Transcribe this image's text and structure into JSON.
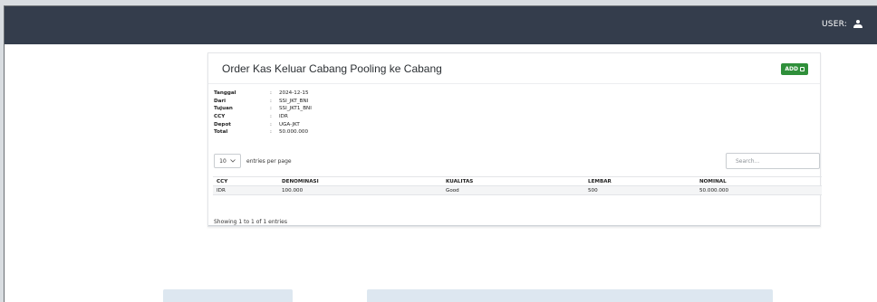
{
  "header": {
    "user_label": "USER:"
  },
  "card": {
    "title": "Order Kas Keluar Cabang Pooling ke Cabang",
    "add_label": "ADD"
  },
  "info": [
    {
      "key": "Tanggal",
      "sep": ":",
      "value": "2024-12-15"
    },
    {
      "key": "Dari",
      "sep": ":",
      "value": "SSI_JKT_BNI"
    },
    {
      "key": "Tujuan",
      "sep": ":",
      "value": "SSI_JKT1_BNI"
    },
    {
      "key": "CCY",
      "sep": ":",
      "value": "IDR"
    },
    {
      "key": "Depot",
      "sep": ":",
      "value": "UGA-JKT"
    },
    {
      "key": "Total",
      "sep": ":",
      "value": "50.000.000"
    }
  ],
  "table_controls": {
    "page_size": "10",
    "page_size_suffix": "entries per page",
    "search_placeholder": "Search..."
  },
  "table": {
    "headers": [
      "CCY",
      "DENOMINASI",
      "KUALITAS",
      "LEMBAR",
      "NOMINAL"
    ],
    "rows": [
      [
        "IDR",
        "100.000",
        "Good",
        "500",
        "50.000.000"
      ]
    ]
  },
  "footer": {
    "showing": "Showing 1 to 1 of 1 entries"
  },
  "icons": {
    "user": "user-icon",
    "add": "square-icon",
    "dropdown": "chevron-down-icon"
  },
  "colors": {
    "topbar": "#343d4c",
    "add_button": "#2f8f3a"
  }
}
